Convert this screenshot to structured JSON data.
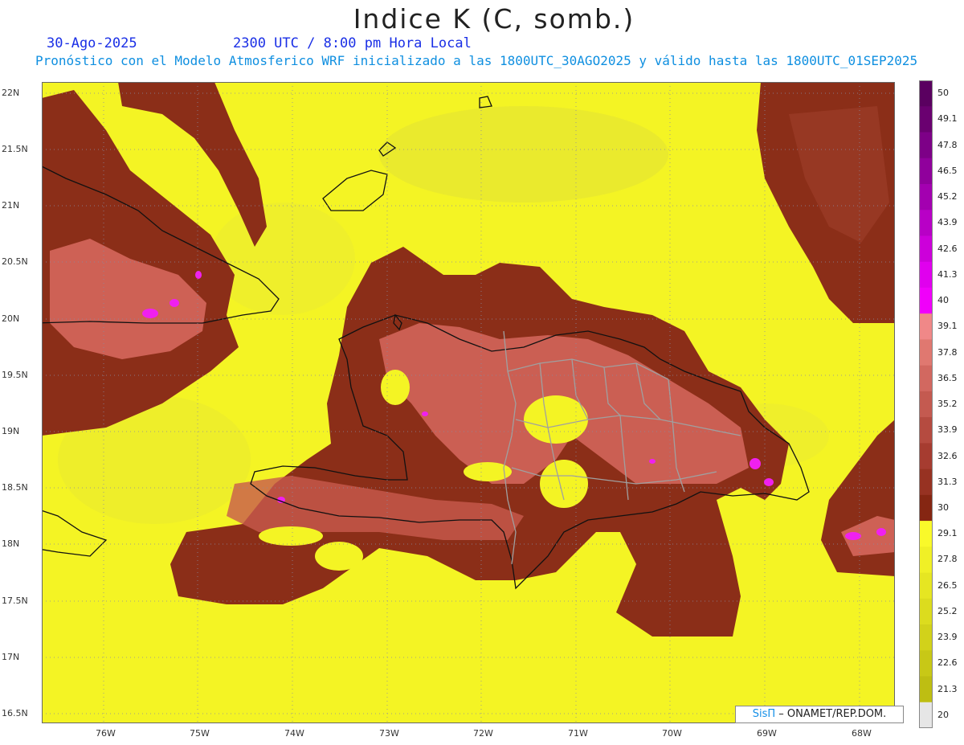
{
  "header": {
    "title": "Indice K (C, somb.)",
    "date": "30-Ago-2025",
    "time": "2300 UTC / 8:00 pm Hora Local",
    "subtitle": "Pronóstico con el Modelo Atmosferico WRF inicializado a las 1800UTC_30AGO2025 y válido hasta las  1800UTC_01SEP2025"
  },
  "map": {
    "lat_labels": [
      "22N",
      "21.5N",
      "21N",
      "20.5N",
      "20N",
      "19.5N",
      "19N",
      "18.5N",
      "18N",
      "17.5N",
      "17N",
      "16.5N"
    ],
    "lon_labels": [
      "76W",
      "75W",
      "74W",
      "73W",
      "72W",
      "71W",
      "70W",
      "69W",
      "68W"
    ],
    "lat_range": [
      16.4,
      22.1
    ],
    "lon_range": [
      -76.65,
      -67.6
    ],
    "grid": "dotted",
    "colors": {
      "low": "#f4f424",
      "mid": "#8b2e18",
      "high": "#d96a60",
      "extreme": "#f020f0",
      "coast": "#111111",
      "provinces": "#a0a0a0"
    }
  },
  "colorbar": {
    "ticks": [
      "50",
      "49.1",
      "47.8",
      "46.5",
      "45.2",
      "43.9",
      "42.6",
      "41.3",
      "40",
      "39.1",
      "37.8",
      "36.5",
      "35.2",
      "33.9",
      "32.6",
      "31.3",
      "30",
      "29.1",
      "27.8",
      "26.5",
      "25.2",
      "23.9",
      "22.6",
      "21.3",
      "20"
    ],
    "bands": [
      "#5a0060",
      "#6a0070",
      "#7d0087",
      "#90009c",
      "#a300b0",
      "#b800c6",
      "#cc00da",
      "#e000ee",
      "#f000fa",
      "#f08888",
      "#e07870",
      "#d26860",
      "#c45a50",
      "#b54b40",
      "#a63c30",
      "#973222",
      "#852612",
      "#f9f92a",
      "#f0f026",
      "#e6e622",
      "#dcdc1e",
      "#d2d21a",
      "#c8c816",
      "#bebe12",
      "#e6e6e6"
    ]
  },
  "credit": {
    "sis": "SisΠ",
    "org": "– ONAMET/REP.DOM."
  }
}
